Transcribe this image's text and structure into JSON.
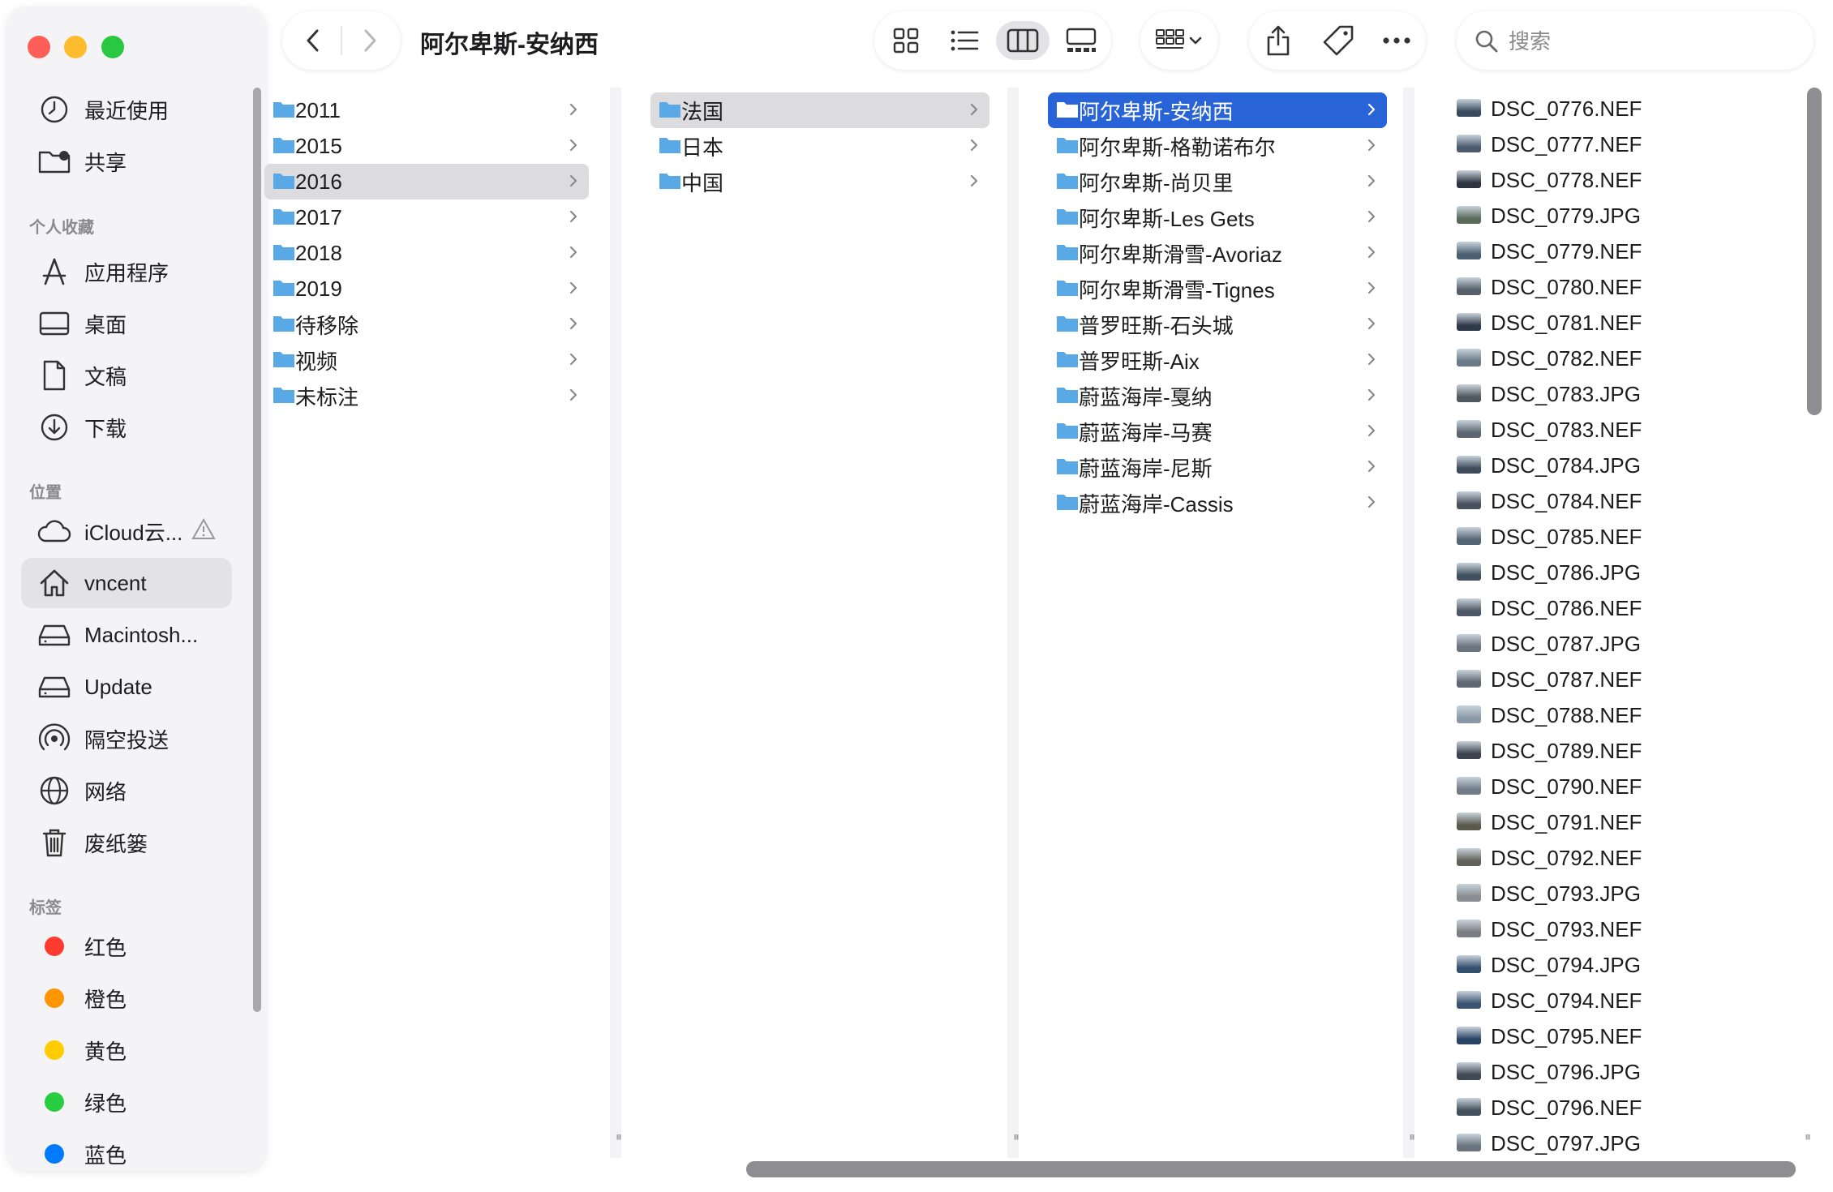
{
  "window": {
    "title": "阿尔卑斯-安纳西"
  },
  "sidebar": {
    "recents": [
      {
        "label": "最近使用",
        "icon": "clock-icon"
      },
      {
        "label": "共享",
        "icon": "shared-folder-icon"
      }
    ],
    "favorites_header": "个人收藏",
    "favorites": [
      {
        "label": "应用程序",
        "icon": "applications-icon"
      },
      {
        "label": "桌面",
        "icon": "desktop-icon"
      },
      {
        "label": "文稿",
        "icon": "document-icon"
      },
      {
        "label": "下载",
        "icon": "download-icon"
      }
    ],
    "locations_header": "位置",
    "locations": [
      {
        "label": "iCloud云...",
        "icon": "cloud-icon"
      },
      {
        "label": "vncent",
        "icon": "home-icon",
        "active": true
      },
      {
        "label": "Macintosh...",
        "icon": "disk-icon"
      },
      {
        "label": "Update",
        "icon": "disk-icon"
      },
      {
        "label": "隔空投送",
        "icon": "airdrop-icon"
      },
      {
        "label": "网络",
        "icon": "network-icon"
      },
      {
        "label": "废纸篓",
        "icon": "trash-icon"
      }
    ],
    "tags_header": "标签",
    "tags": [
      {
        "label": "红色",
        "color": "#ff3b30"
      },
      {
        "label": "橙色",
        "color": "#ff9500"
      },
      {
        "label": "黄色",
        "color": "#ffcc00"
      },
      {
        "label": "绿色",
        "color": "#28cd41"
      },
      {
        "label": "蓝色",
        "color": "#007aff"
      }
    ]
  },
  "search": {
    "placeholder": "搜索",
    "value": ""
  },
  "columns": {
    "years": [
      "2011",
      "2015",
      "2016",
      "2017",
      "2018",
      "2019",
      "待移除",
      "视频",
      "未标注"
    ],
    "countries": [
      "法国",
      "日本",
      "中国"
    ],
    "places": [
      "阿尔卑斯-安纳西",
      "阿尔卑斯-格勒诺布尔",
      "阿尔卑斯-尚贝里",
      "阿尔卑斯-Les Gets",
      "阿尔卑斯滑雪-Avoriaz",
      "阿尔卑斯滑雪-Tignes",
      "普罗旺斯-石头城",
      "普罗旺斯-Aix",
      "蔚蓝海岸-戛纳",
      "蔚蓝海岸-马赛",
      "蔚蓝海岸-尼斯",
      "蔚蓝海岸-Cassis"
    ],
    "files": [
      "DSC_0776.NEF",
      "DSC_0777.NEF",
      "DSC_0778.NEF",
      "DSC_0779.JPG",
      "DSC_0779.NEF",
      "DSC_0780.NEF",
      "DSC_0781.NEF",
      "DSC_0782.NEF",
      "DSC_0783.JPG",
      "DSC_0783.NEF",
      "DSC_0784.JPG",
      "DSC_0784.NEF",
      "DSC_0785.NEF",
      "DSC_0786.JPG",
      "DSC_0786.NEF",
      "DSC_0787.JPG",
      "DSC_0787.NEF",
      "DSC_0788.NEF",
      "DSC_0789.NEF",
      "DSC_0790.NEF",
      "DSC_0791.NEF",
      "DSC_0792.NEF",
      "DSC_0793.JPG",
      "DSC_0793.NEF",
      "DSC_0794.JPG",
      "DSC_0794.NEF",
      "DSC_0795.NEF",
      "DSC_0796.JPG",
      "DSC_0796.NEF",
      "DSC_0797.JPG"
    ]
  },
  "colors": {
    "accent": "#2864d8",
    "folder": "#5aa9e6"
  }
}
